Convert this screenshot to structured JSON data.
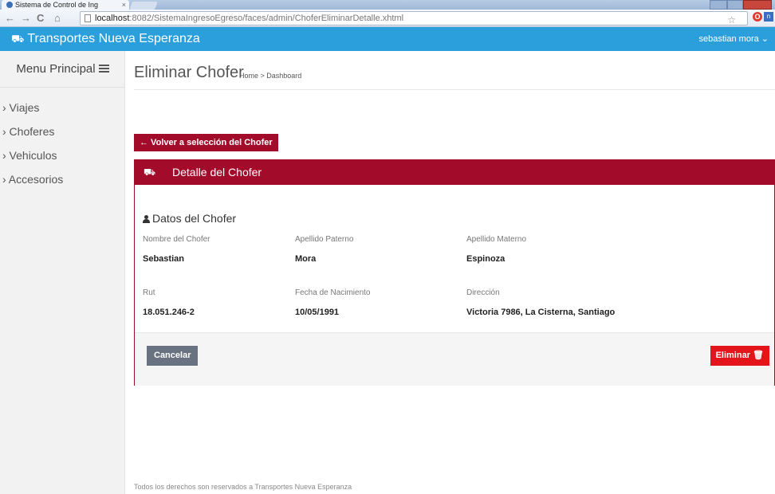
{
  "browser": {
    "tab_title": "Sistema de Control de Ing",
    "tab_close": "×",
    "url_host": "localhost",
    "url_path": ":8082/SistemaIngresoEgreso/faces/admin/ChoferEliminarDetalle.xhtml",
    "ext_opera_label": "O",
    "ext_blue_label": "n"
  },
  "header": {
    "brand": "Transportes Nueva Esperanza",
    "user": "sebastian mora ⌄"
  },
  "sidebar": {
    "title": "Menu Principal",
    "items": [
      {
        "label": "› Viajes"
      },
      {
        "label": "› Choferes"
      },
      {
        "label": "› Vehiculos"
      },
      {
        "label": "› Accesorios"
      }
    ]
  },
  "main": {
    "page_title": "Eliminar Chofer",
    "breadcrumb": "Home > Dashboard",
    "back_button": "← Volver a selección del Chofer",
    "panel_title": "Detalle del Chofer",
    "section_title": "Datos del Chofer",
    "fields": [
      {
        "label": "Nombre del Chofer",
        "value": "Sebastian"
      },
      {
        "label": "Apellido Paterno",
        "value": "Mora"
      },
      {
        "label": "Apellido Materno",
        "value": "Espinoza"
      },
      {
        "label": "Rut",
        "value": "18.051.246-2"
      },
      {
        "label": "Fecha de Nacimiento",
        "value": "10/05/1991"
      },
      {
        "label": "Dirección",
        "value": "Victoria 7986, La Cisterna, Santiago"
      }
    ],
    "cancel_button": "Cancelar",
    "delete_button": "Eliminar 🗑"
  },
  "footer": "Todos los derechos son reservados a Transportes Nueva Esperanza",
  "colors": {
    "appbar": "#2a9fdc",
    "primary_dark_red": "#a30b2b",
    "delete_red": "#e3151b",
    "cancel_gray": "#687280"
  }
}
